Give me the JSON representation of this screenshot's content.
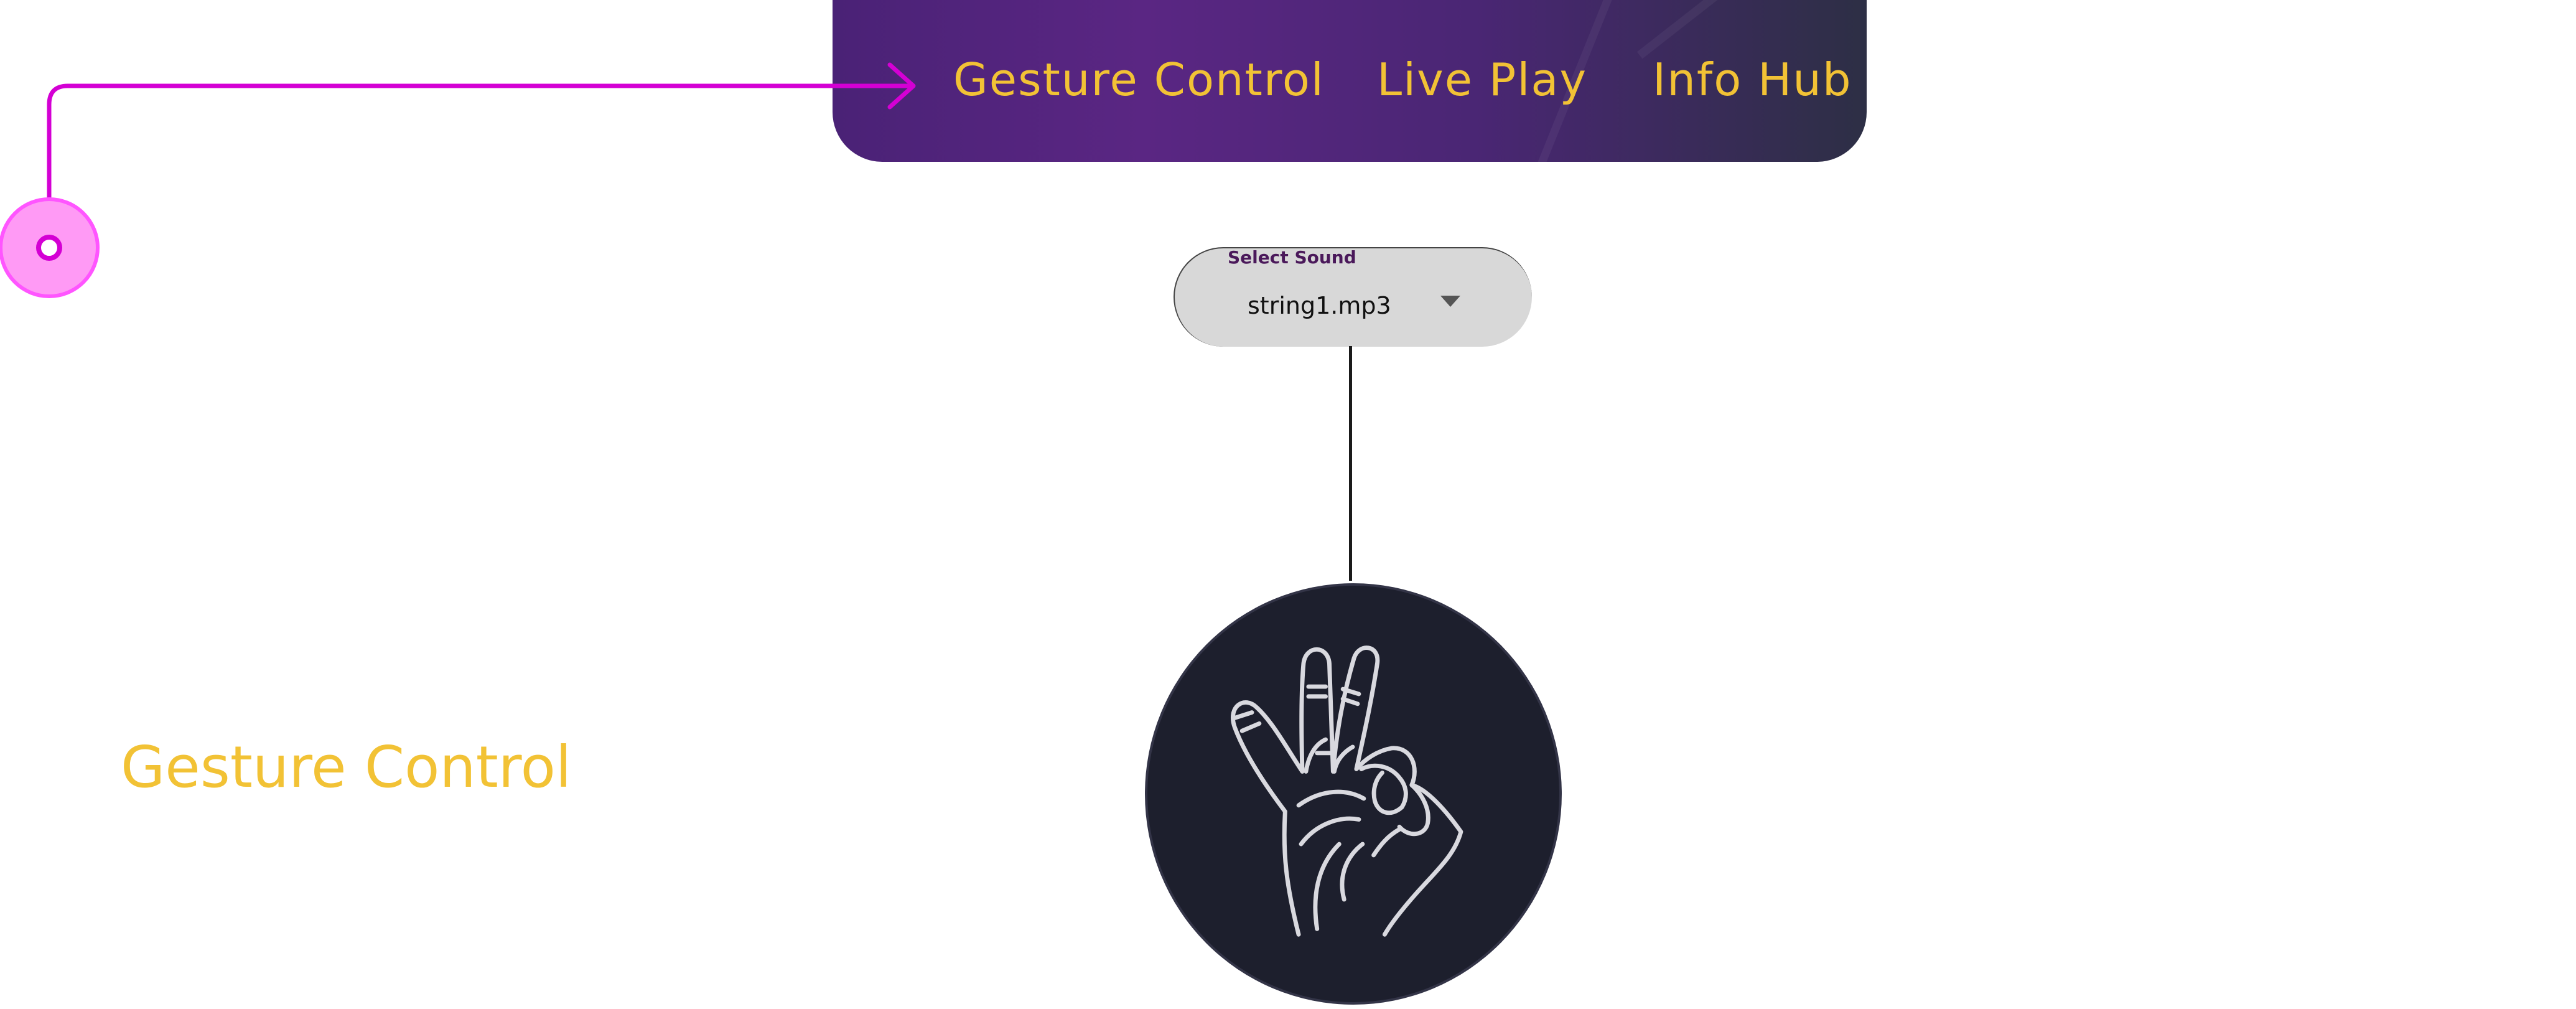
{
  "nav": {
    "items": [
      {
        "label": "Gesture Control"
      },
      {
        "label": "Live Play"
      },
      {
        "label": "Info Hub"
      }
    ]
  },
  "dropdown": {
    "label": "Select Sound",
    "value": "string1.mp3"
  },
  "gesture": {
    "icon": "ok-hand-icon"
  },
  "page": {
    "title": "Gesture Control"
  },
  "colors": {
    "accent": "#f2c235",
    "nav_start": "#4a2276",
    "nav_end": "#2d2f45",
    "tutorial": "#d400d4",
    "circle": "#1d1f2d"
  }
}
